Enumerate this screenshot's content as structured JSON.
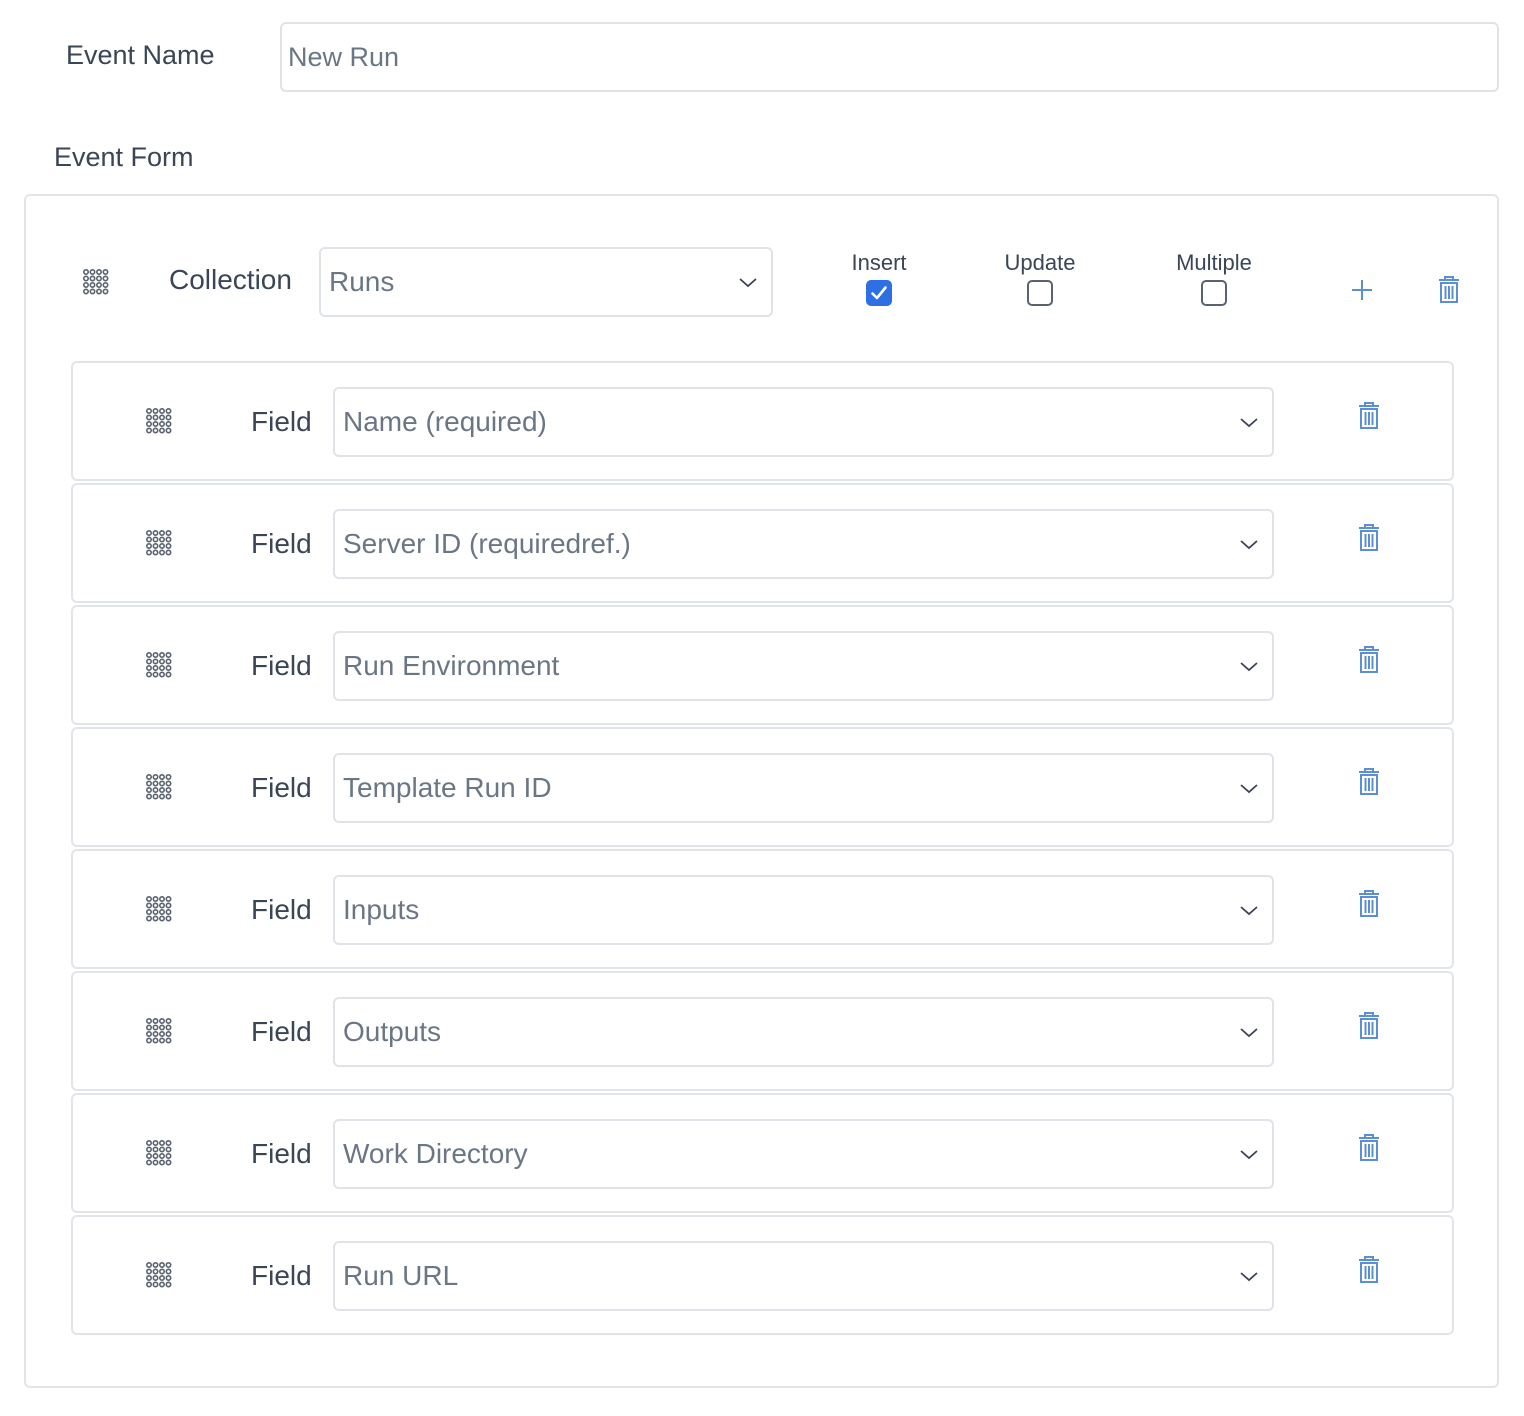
{
  "event_name": {
    "label": "Event Name",
    "value": "New Run"
  },
  "event_form": {
    "label": "Event Form",
    "collection": {
      "label": "Collection",
      "selected": "Runs",
      "drag_icon": "drag-grid-icon",
      "options": {
        "insert": {
          "label": "Insert",
          "checked": true
        },
        "update": {
          "label": "Update",
          "checked": false
        },
        "multiple": {
          "label": "Multiple",
          "checked": false
        }
      },
      "add_icon": "plus-icon",
      "delete_icon": "trash-icon"
    },
    "fields": [
      {
        "label": "Field",
        "selected": "Name (required)"
      },
      {
        "label": "Field",
        "selected": "Server ID (requiredref.)"
      },
      {
        "label": "Field",
        "selected": "Run Environment"
      },
      {
        "label": "Field",
        "selected": "Template Run ID"
      },
      {
        "label": "Field",
        "selected": "Inputs"
      },
      {
        "label": "Field",
        "selected": "Outputs"
      },
      {
        "label": "Field",
        "selected": "Work Directory"
      },
      {
        "label": "Field",
        "selected": "Run URL"
      }
    ]
  },
  "colors": {
    "accent": "#2f6fe4",
    "icon_blue": "#5b8fd1",
    "border": "#dfe3e8",
    "text": "#3a4556",
    "muted_text": "#6b7685"
  }
}
